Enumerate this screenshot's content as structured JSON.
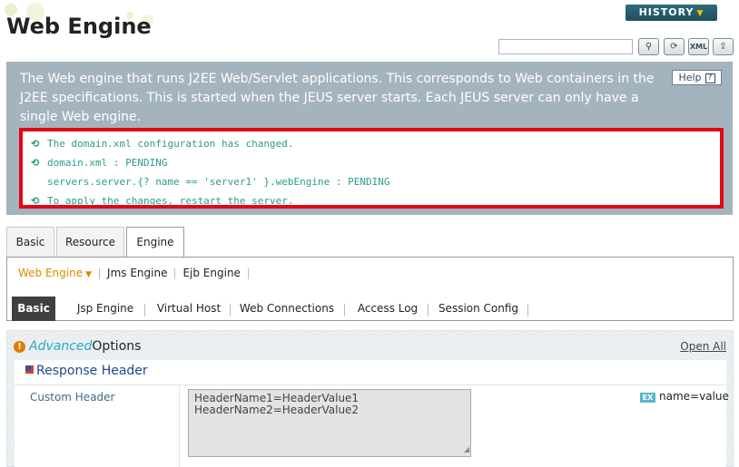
{
  "header": {
    "title": "Web Engine",
    "history_label": "HISTORY",
    "search_placeholder": "",
    "tool_icons": [
      "search-icon",
      "refresh-icon",
      "xml-icon",
      "export-icon"
    ]
  },
  "description": {
    "text": "The Web engine that runs J2EE Web/Servlet applications. This corresponds to Web containers in the J2EE specifications. This is started when the JEUS server starts. Each JEUS server can only have a single Web engine.",
    "help_label": "Help",
    "help_icon": "question-icon"
  },
  "notice": {
    "lines": [
      "The domain.xml configuration has changed.",
      "domain.xml : PENDING",
      "servers.server.{? name == 'server1' }.webEngine : PENDING",
      "To apply the changes, restart the server."
    ],
    "color": "#2b9c8c",
    "border_color": "#e30613"
  },
  "main_tabs": [
    {
      "label": "Basic"
    },
    {
      "label": "Resource"
    },
    {
      "label": "Engine",
      "active": true
    }
  ],
  "engine_nav": [
    {
      "label": "Web Engine",
      "active": true
    },
    {
      "label": "Jms Engine"
    },
    {
      "label": "Ejb Engine"
    }
  ],
  "sub_tabs": [
    {
      "label": "Basic",
      "active": true
    },
    {
      "label": "Jsp Engine"
    },
    {
      "label": "Virtual Host"
    },
    {
      "label": "Web Connections"
    },
    {
      "label": "Access Log"
    },
    {
      "label": "Session Config"
    }
  ],
  "advanced": {
    "advanced_word": "Advanced",
    "options_word": "Options",
    "open_all": "Open All",
    "section_title": "Response Header",
    "field_label": "Custom Header",
    "field_lines": [
      "HeaderName1=HeaderValue1",
      "HeaderName2=HeaderValue2"
    ],
    "example_badge": "EX",
    "example_text": "name=value"
  },
  "colors": {
    "description_bg": "#a4b4be",
    "accent_orange": "#e08700",
    "advanced_cyan": "#2aa9c1",
    "active_subtab_bg": "#404040"
  }
}
